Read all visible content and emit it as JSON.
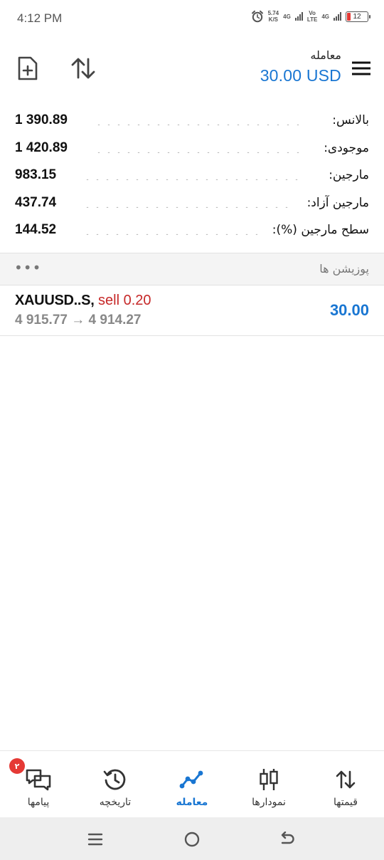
{
  "status_bar": {
    "time": "4:12 PM",
    "net_speed_value": "5.74",
    "net_speed_unit": "K/S",
    "net1": "4G",
    "volte_top": "Vo",
    "volte_bottom": "LTE",
    "net2": "4G",
    "battery": "12",
    "battery_color": "#e53935"
  },
  "header": {
    "title": "معامله",
    "balance": "30.00 USD",
    "new_order_icon": "file-plus-icon",
    "sort_icon": "sort-arrows-icon",
    "menu_icon": "hamburger-icon"
  },
  "summary": [
    {
      "label": "بالانس:",
      "value": "1 390.89"
    },
    {
      "label": "موجودی:",
      "value": "1 420.89"
    },
    {
      "label": "مارجین:",
      "value": "983.15"
    },
    {
      "label": "مارجین آزاد:",
      "value": "437.74"
    },
    {
      "label": "سطح مارجین (%):",
      "value": "144.52"
    }
  ],
  "positions": {
    "section_title": "پوزیشن ها",
    "more": "•••",
    "items": [
      {
        "symbol": "XAUUSD..S,",
        "side": "sell 0.20",
        "open_price": "4 915.77",
        "arrow": "→",
        "current_price": "4 914.27",
        "profit": "30.00"
      }
    ]
  },
  "bottom_nav": [
    {
      "label": "پیامها",
      "icon": "chat-bubbles-icon",
      "badge": "۲",
      "active": false
    },
    {
      "label": "تاریخچه",
      "icon": "history-icon",
      "active": false
    },
    {
      "label": "معامله",
      "icon": "trade-line-icon",
      "active": true
    },
    {
      "label": "نمودارها",
      "icon": "candlestick-icon",
      "active": false
    },
    {
      "label": "قیمتها",
      "icon": "quotes-arrows-icon",
      "active": false
    }
  ],
  "colors": {
    "accent": "#1976d2",
    "sell": "#c62828",
    "badge": "#e53935"
  }
}
